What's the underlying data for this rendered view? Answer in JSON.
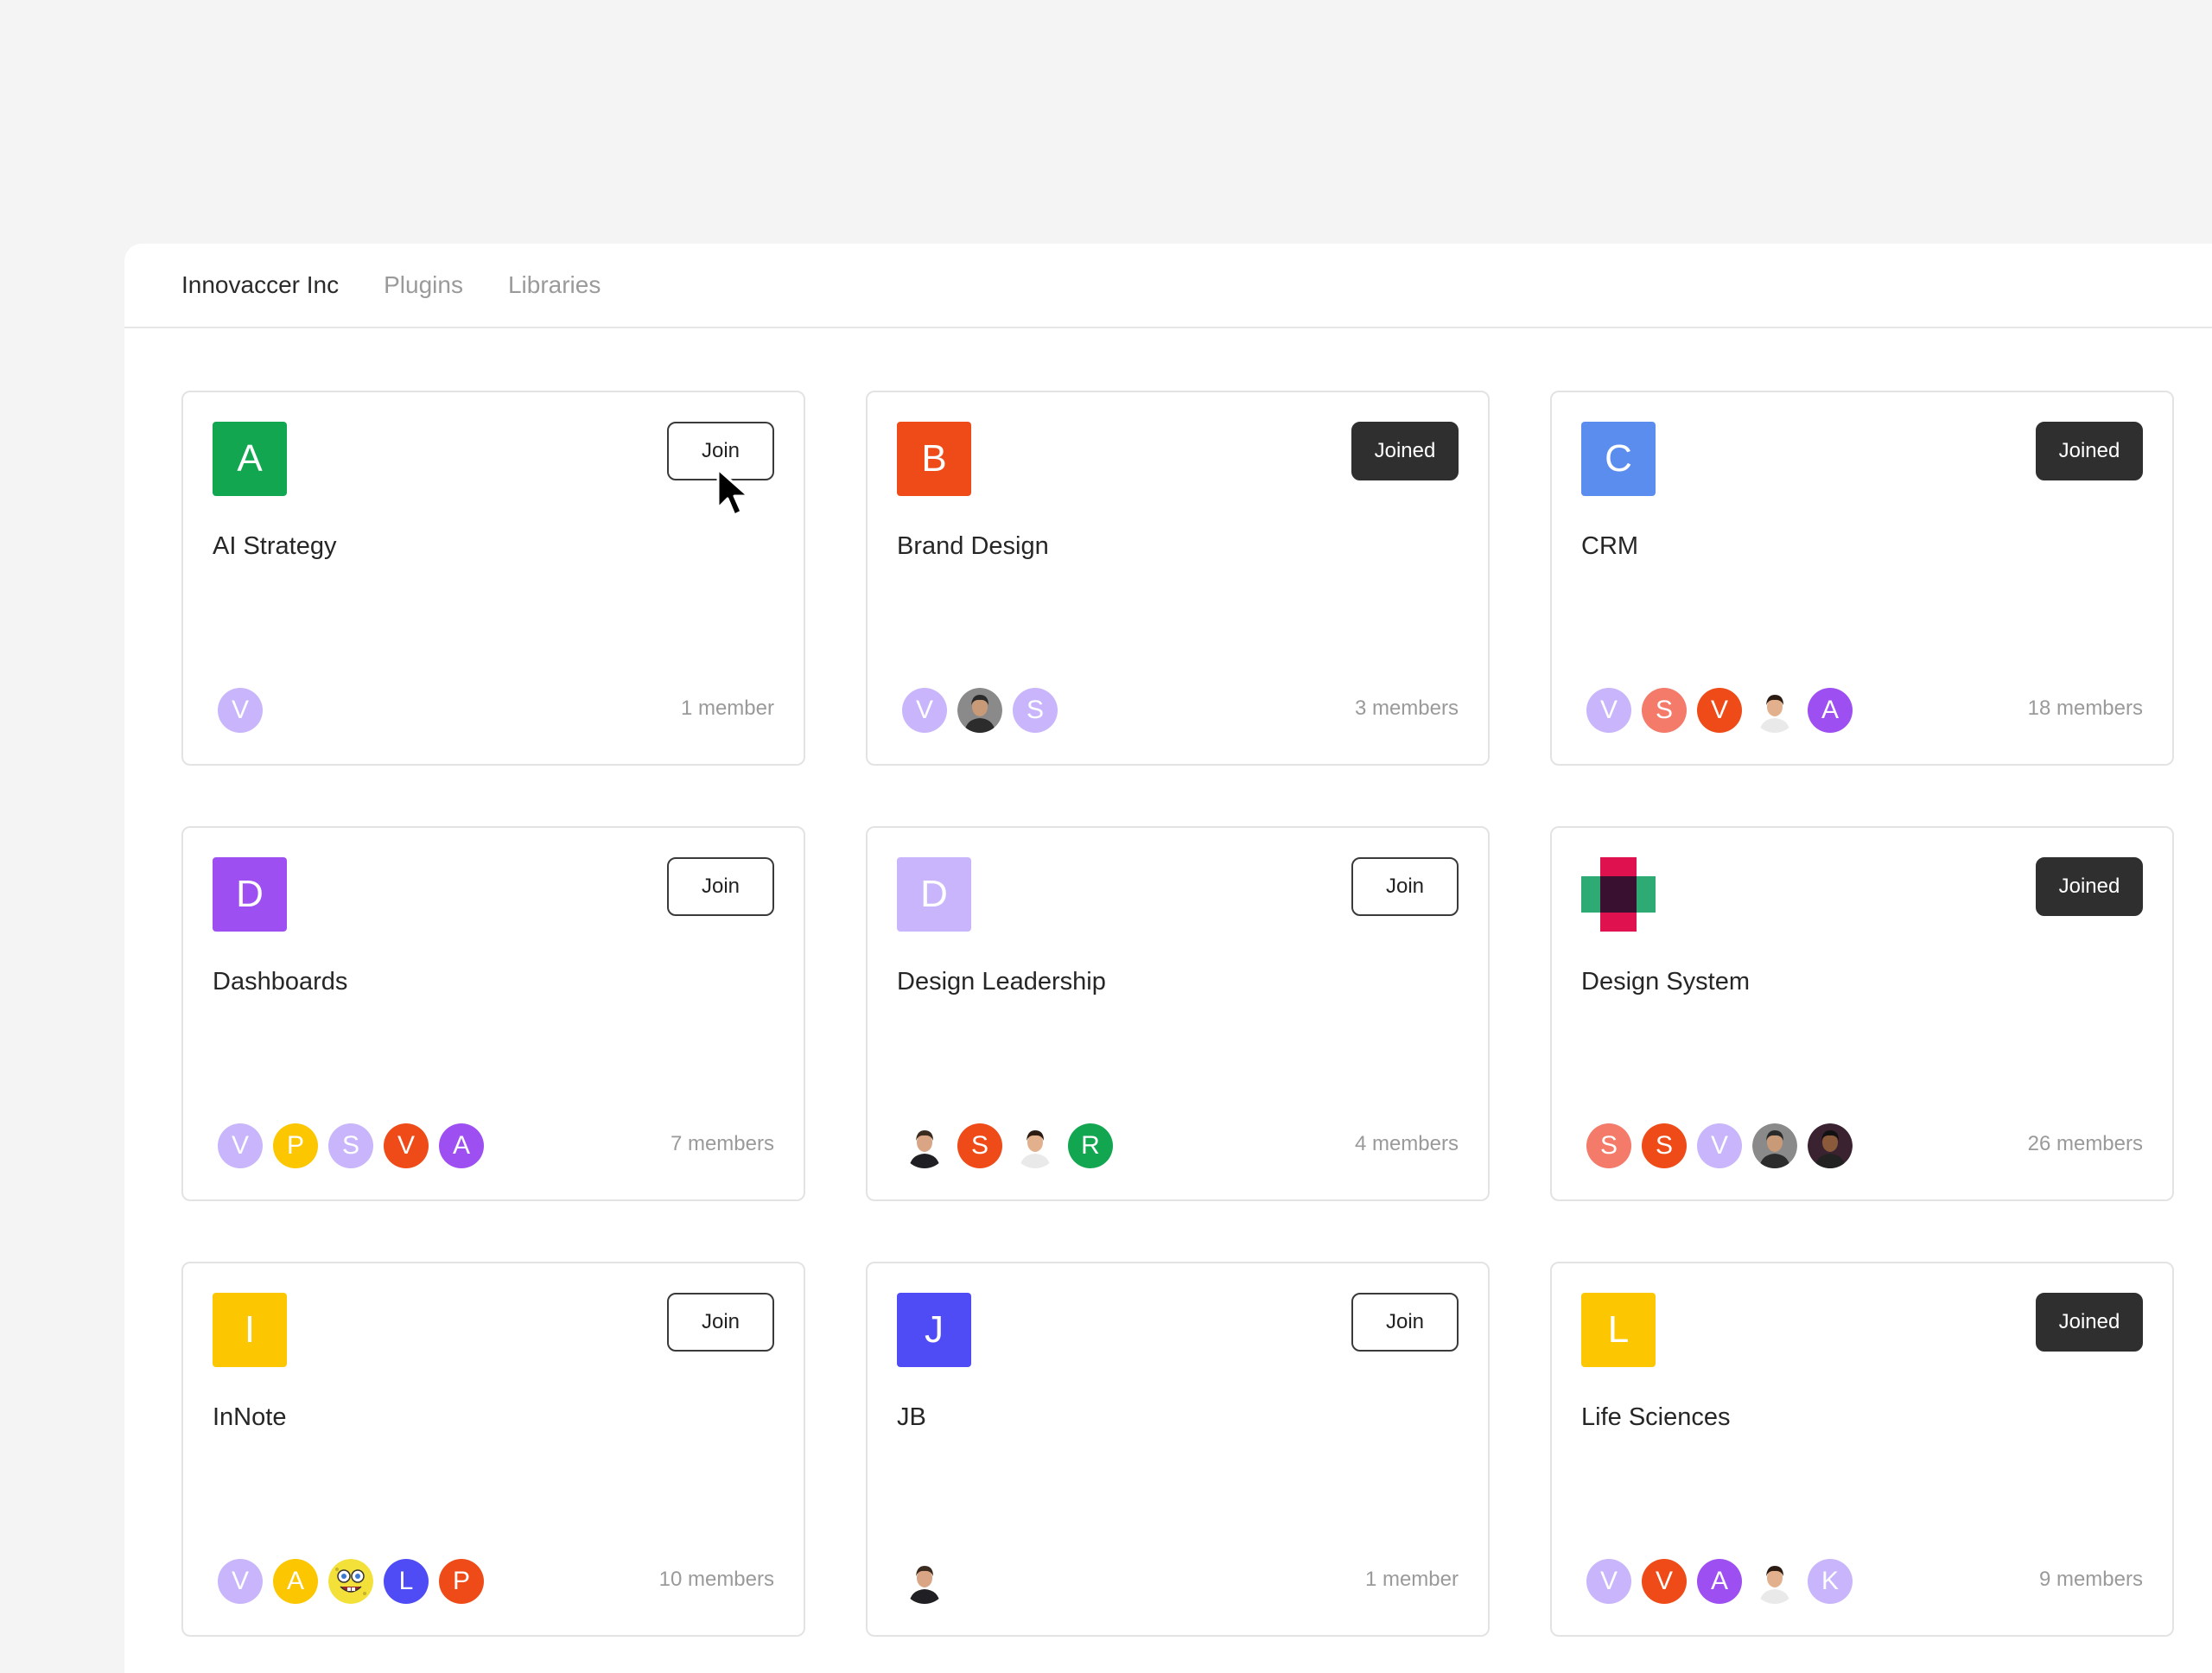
{
  "tabs": [
    {
      "label": "Innovaccer Inc",
      "active": true
    },
    {
      "label": "Plugins",
      "active": false
    },
    {
      "label": "Libraries",
      "active": false
    }
  ],
  "colors": {
    "green": "#12a651",
    "orange": "#ef4b18",
    "blue": "#5b8def",
    "purple": "#9e4ff2",
    "lavender": "#c9b5fb",
    "yellow": "#fcc600",
    "indigo": "#4f4cf5",
    "salmon": "#f47a6a"
  },
  "cards": [
    {
      "letter": "A",
      "color": "#12a651",
      "title": "AI Strategy",
      "button": "Join",
      "joined": false,
      "count": "1 member",
      "members": [
        {
          "letter": "V",
          "color": "#c9b5fb"
        }
      ]
    },
    {
      "letter": "B",
      "color": "#ef4b18",
      "title": "Brand Design",
      "button": "Joined",
      "joined": true,
      "count": "3 members",
      "members": [
        {
          "letter": "V",
          "color": "#c9b5fb"
        },
        {
          "photo": "man-beard-photo"
        },
        {
          "letter": "S",
          "color": "#c9b5fb"
        }
      ]
    },
    {
      "letter": "C",
      "color": "#5b8def",
      "title": "CRM",
      "button": "Joined",
      "joined": true,
      "count": "18 members",
      "members": [
        {
          "letter": "V",
          "color": "#c9b5fb"
        },
        {
          "letter": "S",
          "color": "#f47a6a"
        },
        {
          "letter": "V",
          "color": "#ef4b18"
        },
        {
          "photo": "man-smiling-photo"
        },
        {
          "letter": "A",
          "color": "#9e4ff2"
        }
      ]
    },
    {
      "letter": "D",
      "color": "#9e4ff2",
      "title": "Dashboards",
      "button": "Join",
      "joined": false,
      "count": "7 members",
      "members": [
        {
          "letter": "V",
          "color": "#c9b5fb"
        },
        {
          "letter": "P",
          "color": "#fcc600"
        },
        {
          "letter": "S",
          "color": "#c9b5fb"
        },
        {
          "letter": "V",
          "color": "#ef4b18"
        },
        {
          "letter": "A",
          "color": "#9e4ff2"
        }
      ]
    },
    {
      "letter": "D",
      "color": "#c9b5fb",
      "title": "Design Leadership",
      "button": "Join",
      "joined": false,
      "count": "4 members",
      "members": [
        {
          "photo": "man-suit-photo"
        },
        {
          "letter": "S",
          "color": "#ef4b18"
        },
        {
          "photo": "man-smiling-photo"
        },
        {
          "letter": "R",
          "color": "#12a651"
        }
      ]
    },
    {
      "logo": "design-system-logo",
      "title": "Design System",
      "button": "Joined",
      "joined": true,
      "count": "26 members",
      "members": [
        {
          "letter": "S",
          "color": "#f47a6a"
        },
        {
          "letter": "S",
          "color": "#ef4b18"
        },
        {
          "letter": "V",
          "color": "#c9b5fb"
        },
        {
          "photo": "man-beard-photo"
        },
        {
          "photo": "man-dark-photo"
        }
      ]
    },
    {
      "letter": "I",
      "color": "#fcc600",
      "title": "InNote",
      "button": "Join",
      "joined": false,
      "count": "10 members",
      "members": [
        {
          "letter": "V",
          "color": "#c9b5fb"
        },
        {
          "letter": "A",
          "color": "#fcc600"
        },
        {
          "photo": "sponge-character-photo"
        },
        {
          "letter": "L",
          "color": "#4f4cf5"
        },
        {
          "letter": "P",
          "color": "#ef4b18"
        }
      ]
    },
    {
      "letter": "J",
      "color": "#4f4cf5",
      "title": "JB",
      "button": "Join",
      "joined": false,
      "count": "1 member",
      "members": [
        {
          "photo": "man-suit-photo"
        }
      ]
    },
    {
      "letter": "L",
      "color": "#fcc600",
      "title": "Life Sciences",
      "button": "Joined",
      "joined": true,
      "count": "9 members",
      "members": [
        {
          "letter": "V",
          "color": "#c9b5fb"
        },
        {
          "letter": "V",
          "color": "#ef4b18"
        },
        {
          "letter": "A",
          "color": "#9e4ff2"
        },
        {
          "photo": "man-smiling-photo"
        },
        {
          "letter": "K",
          "color": "#c9b5fb"
        }
      ]
    }
  ]
}
